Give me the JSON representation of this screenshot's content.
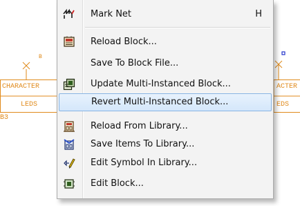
{
  "colors": {
    "schematic": "#e08a1a",
    "pin_marker": "#2233cc",
    "menu_bg": "#f3f3f3",
    "highlight_bg": "#d4e7fb",
    "highlight_border": "#88b4e3"
  },
  "schematic": {
    "left_block": {
      "top_label": "CHARACTER",
      "bottom_label": "LEDS",
      "ref": "B3",
      "pin": "B"
    },
    "right_block": {
      "top_label": "ACTER",
      "bottom_label": "EDS"
    }
  },
  "menu": {
    "items": [
      {
        "label": "Mark Net",
        "shortcut": "H",
        "icon": "mark-net-icon"
      },
      {
        "label": "Reload Block...",
        "icon": "reload-block-icon"
      },
      {
        "label": "Save To Block File...",
        "icon": ""
      },
      {
        "label": "Update Multi-Instanced Block...",
        "icon": "update-block-icon"
      },
      {
        "label": "Revert Multi-Instanced Block...",
        "icon": "",
        "highlighted": true
      },
      {
        "label": "Reload From Library...",
        "icon": "reload-library-icon"
      },
      {
        "label": "Save Items To Library...",
        "icon": "save-library-icon"
      },
      {
        "label": "Edit Symbol In Library...",
        "icon": "edit-symbol-icon"
      },
      {
        "label": "Edit Block...",
        "icon": "edit-block-icon"
      }
    ]
  }
}
